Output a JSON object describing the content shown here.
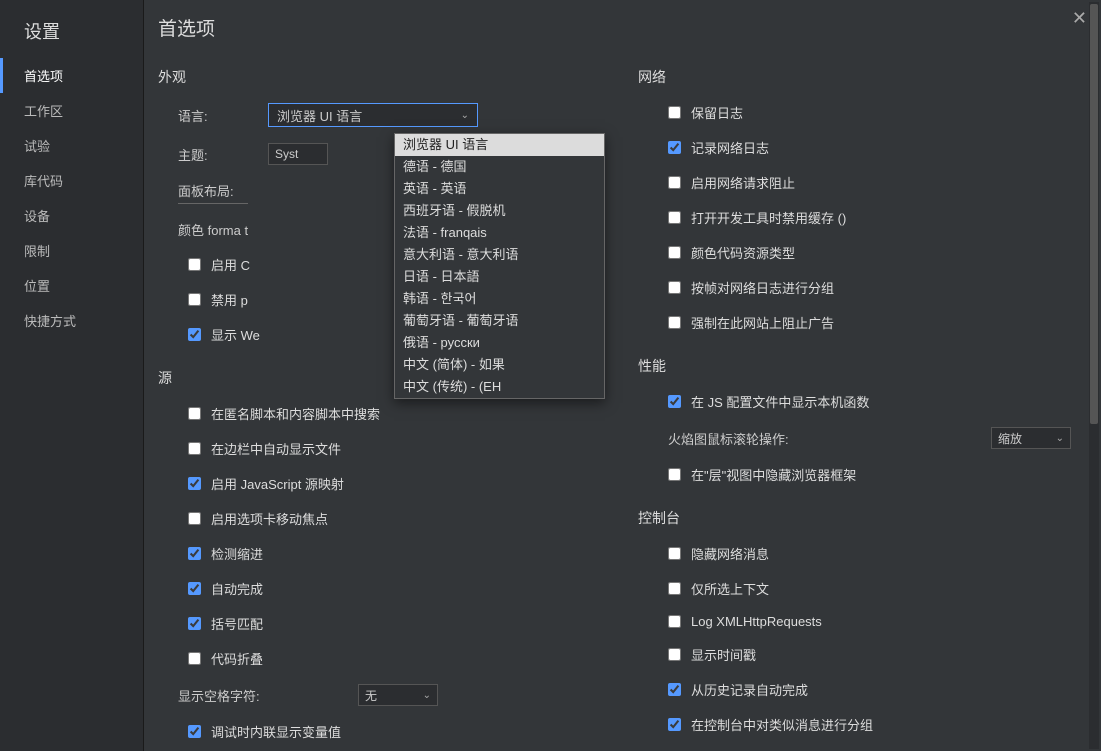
{
  "sidebar": {
    "title": "设置",
    "items": [
      {
        "label": "首选项",
        "active": true
      },
      {
        "label": "工作区"
      },
      {
        "label": "试验"
      },
      {
        "label": "库代码"
      },
      {
        "label": "设备"
      },
      {
        "label": "限制"
      },
      {
        "label": "位置"
      },
      {
        "label": "快捷方式"
      }
    ]
  },
  "main_title": "首选项",
  "appearance": {
    "title": "外观",
    "language_label": "语言:",
    "language_value": "浏览器 UI 语言",
    "theme_label": "主题:",
    "theme_value": "Syst",
    "panel_label": "面板布局:",
    "color_fmt_label": "颜色 forma   t",
    "enable_label": "启用    C",
    "disable_label": "禁用    p",
    "show_label": "显示    We"
  },
  "language_options": [
    "浏览器 UI 语言",
    "德语 - 德国",
    "英语 - 英语",
    "西班牙语 - 假脱机",
    "法语 - franqais",
    "意大利语 - 意大利语",
    "日语 -           日本語",
    "韩语 -        한국어",
    "葡萄牙语 - 葡萄牙语",
    "俄语 - русски",
    "中文 (简体) - 如果",
    "中文 (传统) - (EH"
  ],
  "sources": {
    "title": "源",
    "search_anonymous": "在匿名脚本和内容脚本中搜索",
    "auto_reveal": "在边栏中自动显示文件",
    "enable_js_map": "启用 JavaScript 源映射",
    "enable_tab_focus": "启用选项卡移动焦点",
    "detect_indent": "检测缩进",
    "auto_complete": "自动完成",
    "bracket_match": "括号匹配",
    "code_fold": "代码折叠",
    "whitespace_label": "显示空格字符:",
    "whitespace_value": "无",
    "inline_vars": "调试时内联显示变量值"
  },
  "network": {
    "title": "网络",
    "preserve_log": "保留日志",
    "record_log": "记录网络日志",
    "enable_blocking": "启用网络请求阻止",
    "disable_cache": "打开开发工具时禁用缓存 ()",
    "color_code": "颜色代码资源类型",
    "group_frame": "按帧对网络日志进行分组",
    "force_block_ads": "强制在此网站上阻止广告"
  },
  "performance": {
    "title": "性能",
    "native_fn": "在 JS 配置文件中显示本机函数",
    "flame_label": "火焰图鼠标滚轮操作:",
    "flame_value": "缩放",
    "hide_frames": "在\"层\"视图中隐藏浏览器框架"
  },
  "console": {
    "title": "控制台",
    "hide_network": "隐藏网络消息",
    "selected_context": "仅所选上下文",
    "log_xhr": "Log XMLHttpRequests",
    "show_ts": "显示时间戳",
    "autocomplete_history": "从历史记录自动完成",
    "group_similar": "在控制台中对类似消息进行分组"
  }
}
